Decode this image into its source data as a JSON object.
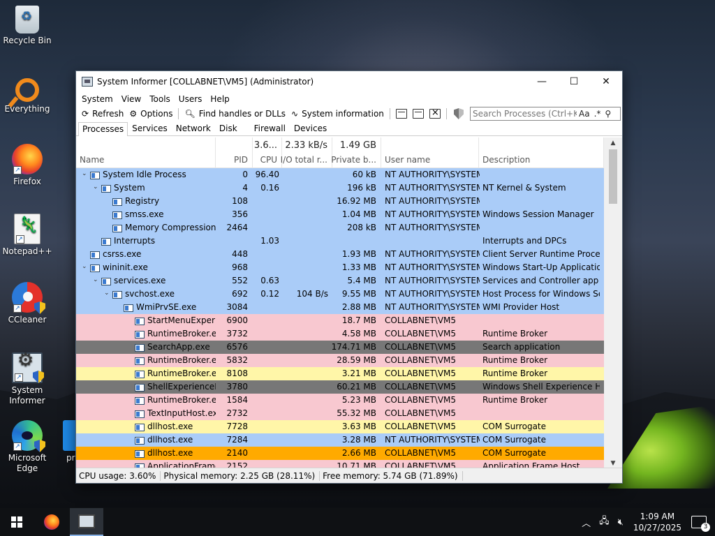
{
  "desktop": {
    "icons": [
      {
        "label": "Recycle Bin"
      },
      {
        "label": "Everything"
      },
      {
        "label": "Firefox"
      },
      {
        "label": "Notepad++"
      },
      {
        "label": "CCleaner"
      },
      {
        "label": "System Informer"
      },
      {
        "label": "Microsoft Edge"
      },
      {
        "label": "pr"
      }
    ]
  },
  "window": {
    "title": "System Informer [COLLABNET\\VM5] (Administrator)",
    "controls": {
      "minimize": "—",
      "maximize": "☐",
      "close": "✕"
    },
    "menu": [
      "System",
      "View",
      "Tools",
      "Users",
      "Help"
    ],
    "toolbar": {
      "refresh": "Refresh",
      "options": "Options",
      "find": "Find handles or DLLs",
      "sysinfo": "System information",
      "search_placeholder": "Search Processes (Ctrl+K)",
      "search_case": "Aa",
      "search_regex": ".*"
    },
    "tabs": [
      "Processes",
      "Services",
      "Network",
      "Disk",
      "Firewall",
      "Devices"
    ],
    "columns": {
      "name": "Name",
      "pid": "PID",
      "cpu": "CPU",
      "io": "I/O total r...",
      "priv": "Private b...",
      "user": "User name",
      "desc": "Description"
    },
    "totals": {
      "cpu": "3.6...",
      "io": "2.33 kB/s",
      "priv": "1.49 GB"
    },
    "colors": {
      "system": "#aaccf8",
      "service": "#f8c8d0",
      "suspended": "#777777",
      "immersive": "#f8c8d0",
      "own": "#fff6a8",
      "highlight": "#ffaa00"
    },
    "processes": [
      {
        "name": "System Idle Process",
        "depth": 0,
        "exp": "v",
        "pid": "0",
        "cpu": "96.40",
        "io": "",
        "priv": "60 kB",
        "user": "NT AUTHORITY\\SYSTEM",
        "desc": "",
        "color": "#aaccf8"
      },
      {
        "name": "System",
        "depth": 1,
        "exp": "v",
        "pid": "4",
        "cpu": "0.16",
        "io": "",
        "priv": "196 kB",
        "user": "NT AUTHORITY\\SYSTEM",
        "desc": "NT Kernel & System",
        "color": "#aaccf8"
      },
      {
        "name": "Registry",
        "depth": 2,
        "exp": "",
        "pid": "108",
        "cpu": "",
        "io": "",
        "priv": "16.92 MB",
        "user": "NT AUTHORITY\\SYSTEM",
        "desc": "",
        "color": "#aaccf8"
      },
      {
        "name": "smss.exe",
        "depth": 2,
        "exp": "",
        "pid": "356",
        "cpu": "",
        "io": "",
        "priv": "1.04 MB",
        "user": "NT AUTHORITY\\SYSTEM",
        "desc": "Windows Session Manager",
        "color": "#aaccf8"
      },
      {
        "name": "Memory Compression",
        "depth": 2,
        "exp": "",
        "pid": "2464",
        "cpu": "",
        "io": "",
        "priv": "208 kB",
        "user": "NT AUTHORITY\\SYSTEM",
        "desc": "",
        "color": "#aaccf8"
      },
      {
        "name": "Interrupts",
        "depth": 1,
        "exp": "",
        "pid": "",
        "cpu": "1.03",
        "io": "",
        "priv": "",
        "user": "",
        "desc": "Interrupts and DPCs",
        "color": "#aaccf8"
      },
      {
        "name": "csrss.exe",
        "depth": 0,
        "exp": "",
        "pid": "448",
        "cpu": "",
        "io": "",
        "priv": "1.93 MB",
        "user": "NT AUTHORITY\\SYSTEM",
        "desc": "Client Server Runtime Process",
        "color": "#aaccf8"
      },
      {
        "name": "wininit.exe",
        "depth": 0,
        "exp": "v",
        "pid": "968",
        "cpu": "",
        "io": "",
        "priv": "1.33 MB",
        "user": "NT AUTHORITY\\SYSTEM",
        "desc": "Windows Start-Up Application",
        "color": "#aaccf8"
      },
      {
        "name": "services.exe",
        "depth": 1,
        "exp": "v",
        "pid": "552",
        "cpu": "0.63",
        "io": "",
        "priv": "5.4 MB",
        "user": "NT AUTHORITY\\SYSTEM",
        "desc": "Services and Controller app",
        "color": "#aaccf8"
      },
      {
        "name": "svchost.exe",
        "depth": 2,
        "exp": "v",
        "pid": "692",
        "cpu": "0.12",
        "io": "104 B/s",
        "priv": "9.55 MB",
        "user": "NT AUTHORITY\\SYSTEM",
        "desc": "Host Process for Windows Ser...",
        "color": "#aaccf8"
      },
      {
        "name": "WmiPrvSE.exe",
        "depth": 3,
        "exp": "",
        "pid": "3084",
        "cpu": "",
        "io": "",
        "priv": "2.88 MB",
        "user": "NT AUTHORITY\\SYSTEM",
        "desc": "WMI Provider Host",
        "color": "#aaccf8"
      },
      {
        "name": "StartMenuExperie...",
        "depth": 4,
        "exp": "",
        "pid": "6900",
        "cpu": "",
        "io": "",
        "priv": "18.7 MB",
        "user": "COLLABNET\\VM5",
        "desc": "",
        "color": "#f8c8d0"
      },
      {
        "name": "RuntimeBroker.exe",
        "depth": 4,
        "exp": "",
        "pid": "3732",
        "cpu": "",
        "io": "",
        "priv": "4.58 MB",
        "user": "COLLABNET\\VM5",
        "desc": "Runtime Broker",
        "color": "#f8c8d0"
      },
      {
        "name": "SearchApp.exe",
        "depth": 4,
        "exp": "",
        "pid": "6576",
        "cpu": "",
        "io": "",
        "priv": "174.71 MB",
        "user": "COLLABNET\\VM5",
        "desc": "Search application",
        "color": "#777777"
      },
      {
        "name": "RuntimeBroker.exe",
        "depth": 4,
        "exp": "",
        "pid": "5832",
        "cpu": "",
        "io": "",
        "priv": "28.59 MB",
        "user": "COLLABNET\\VM5",
        "desc": "Runtime Broker",
        "color": "#f8c8d0"
      },
      {
        "name": "RuntimeBroker.exe",
        "depth": 4,
        "exp": "",
        "pid": "8108",
        "cpu": "",
        "io": "",
        "priv": "3.21 MB",
        "user": "COLLABNET\\VM5",
        "desc": "Runtime Broker",
        "color": "#fff6a8"
      },
      {
        "name": "ShellExperienceH...",
        "depth": 4,
        "exp": "",
        "pid": "3780",
        "cpu": "",
        "io": "",
        "priv": "60.21 MB",
        "user": "COLLABNET\\VM5",
        "desc": "Windows Shell Experience Host",
        "color": "#777777"
      },
      {
        "name": "RuntimeBroker.exe",
        "depth": 4,
        "exp": "",
        "pid": "1584",
        "cpu": "",
        "io": "",
        "priv": "5.23 MB",
        "user": "COLLABNET\\VM5",
        "desc": "Runtime Broker",
        "color": "#f8c8d0"
      },
      {
        "name": "TextInputHost.exe",
        "depth": 4,
        "exp": "",
        "pid": "2732",
        "cpu": "",
        "io": "",
        "priv": "55.32 MB",
        "user": "COLLABNET\\VM5",
        "desc": "",
        "color": "#f8c8d0"
      },
      {
        "name": "dllhost.exe",
        "depth": 4,
        "exp": "",
        "pid": "7728",
        "cpu": "",
        "io": "",
        "priv": "3.63 MB",
        "user": "COLLABNET\\VM5",
        "desc": "COM Surrogate",
        "color": "#fff6a8"
      },
      {
        "name": "dllhost.exe",
        "depth": 4,
        "exp": "",
        "pid": "7284",
        "cpu": "",
        "io": "",
        "priv": "3.28 MB",
        "user": "NT AUTHORITY\\SYSTEM",
        "desc": "COM Surrogate",
        "color": "#aaccf8"
      },
      {
        "name": "dllhost.exe",
        "depth": 4,
        "exp": "",
        "pid": "2140",
        "cpu": "",
        "io": "",
        "priv": "2.66 MB",
        "user": "COLLABNET\\VM5",
        "desc": "COM Surrogate",
        "color": "#ffaa00"
      },
      {
        "name": "ApplicationFrame...",
        "depth": 4,
        "exp": "",
        "pid": "2152",
        "cpu": "",
        "io": "",
        "priv": "10.71 MB",
        "user": "COLLABNET\\VM5",
        "desc": "Application Frame Host",
        "color": "#f8c8d0"
      }
    ],
    "status": {
      "cpu": "CPU usage: 3.60%",
      "phys": "Physical memory: 2.25 GB (28.11%)",
      "free": "Free memory: 5.74 GB (71.89%)"
    }
  },
  "taskbar": {
    "time": "1:09 AM",
    "date": "10/27/2025",
    "notifications": "3"
  }
}
